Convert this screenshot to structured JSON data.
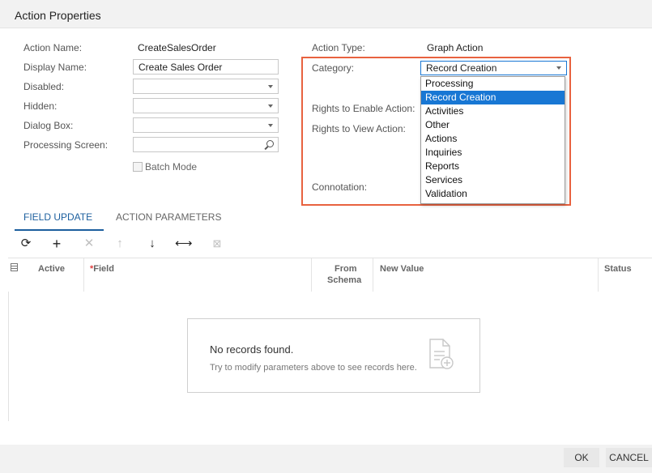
{
  "dialog": {
    "title": "Action Properties"
  },
  "form": {
    "action_name": {
      "label": "Action Name:",
      "value": "CreateSalesOrder"
    },
    "display_name": {
      "label": "Display Name:",
      "value": "Create Sales Order"
    },
    "disabled": {
      "label": "Disabled:",
      "value": ""
    },
    "hidden": {
      "label": "Hidden:",
      "value": ""
    },
    "dialog_box": {
      "label": "Dialog Box:",
      "value": ""
    },
    "processing_screen": {
      "label": "Processing Screen:",
      "value": ""
    },
    "batch_mode": {
      "label": "Batch Mode",
      "checked": false
    },
    "action_type": {
      "label": "Action Type:",
      "value": "Graph Action"
    },
    "category": {
      "label": "Category:",
      "value": "Record Creation"
    },
    "rights_enable": {
      "label": "Rights to Enable Action:"
    },
    "rights_view": {
      "label": "Rights to View Action:"
    },
    "connotation": {
      "label": "Connotation:"
    }
  },
  "category_dropdown": {
    "options": [
      "Processing",
      "Record Creation",
      "Activities",
      "Other",
      "Actions",
      "Inquiries",
      "Reports",
      "Services",
      "Validation"
    ],
    "selected": "Record Creation"
  },
  "tabs": [
    {
      "label": "FIELD UPDATE",
      "active": true
    },
    {
      "label": "ACTION PARAMETERS",
      "active": false
    }
  ],
  "toolbar": {
    "refresh": "⟳",
    "add": "+",
    "delete": "✕",
    "up": "↑",
    "down": "↓",
    "fit": "⟷",
    "excel": "⊠"
  },
  "grid": {
    "columns": {
      "active": "Active",
      "field_required": "*",
      "field": "Field",
      "from_schema_1": "From",
      "from_schema_2": "Schema",
      "new_value": "New Value",
      "status": "Status"
    },
    "empty_title": "No records found.",
    "empty_subtitle": "Try to modify parameters above to see records here."
  },
  "footer": {
    "ok": "OK",
    "cancel": "CANCEL"
  },
  "colors": {
    "accent": "#1c5f9e",
    "highlight": "#e8623f",
    "selected": "#1877d4"
  }
}
